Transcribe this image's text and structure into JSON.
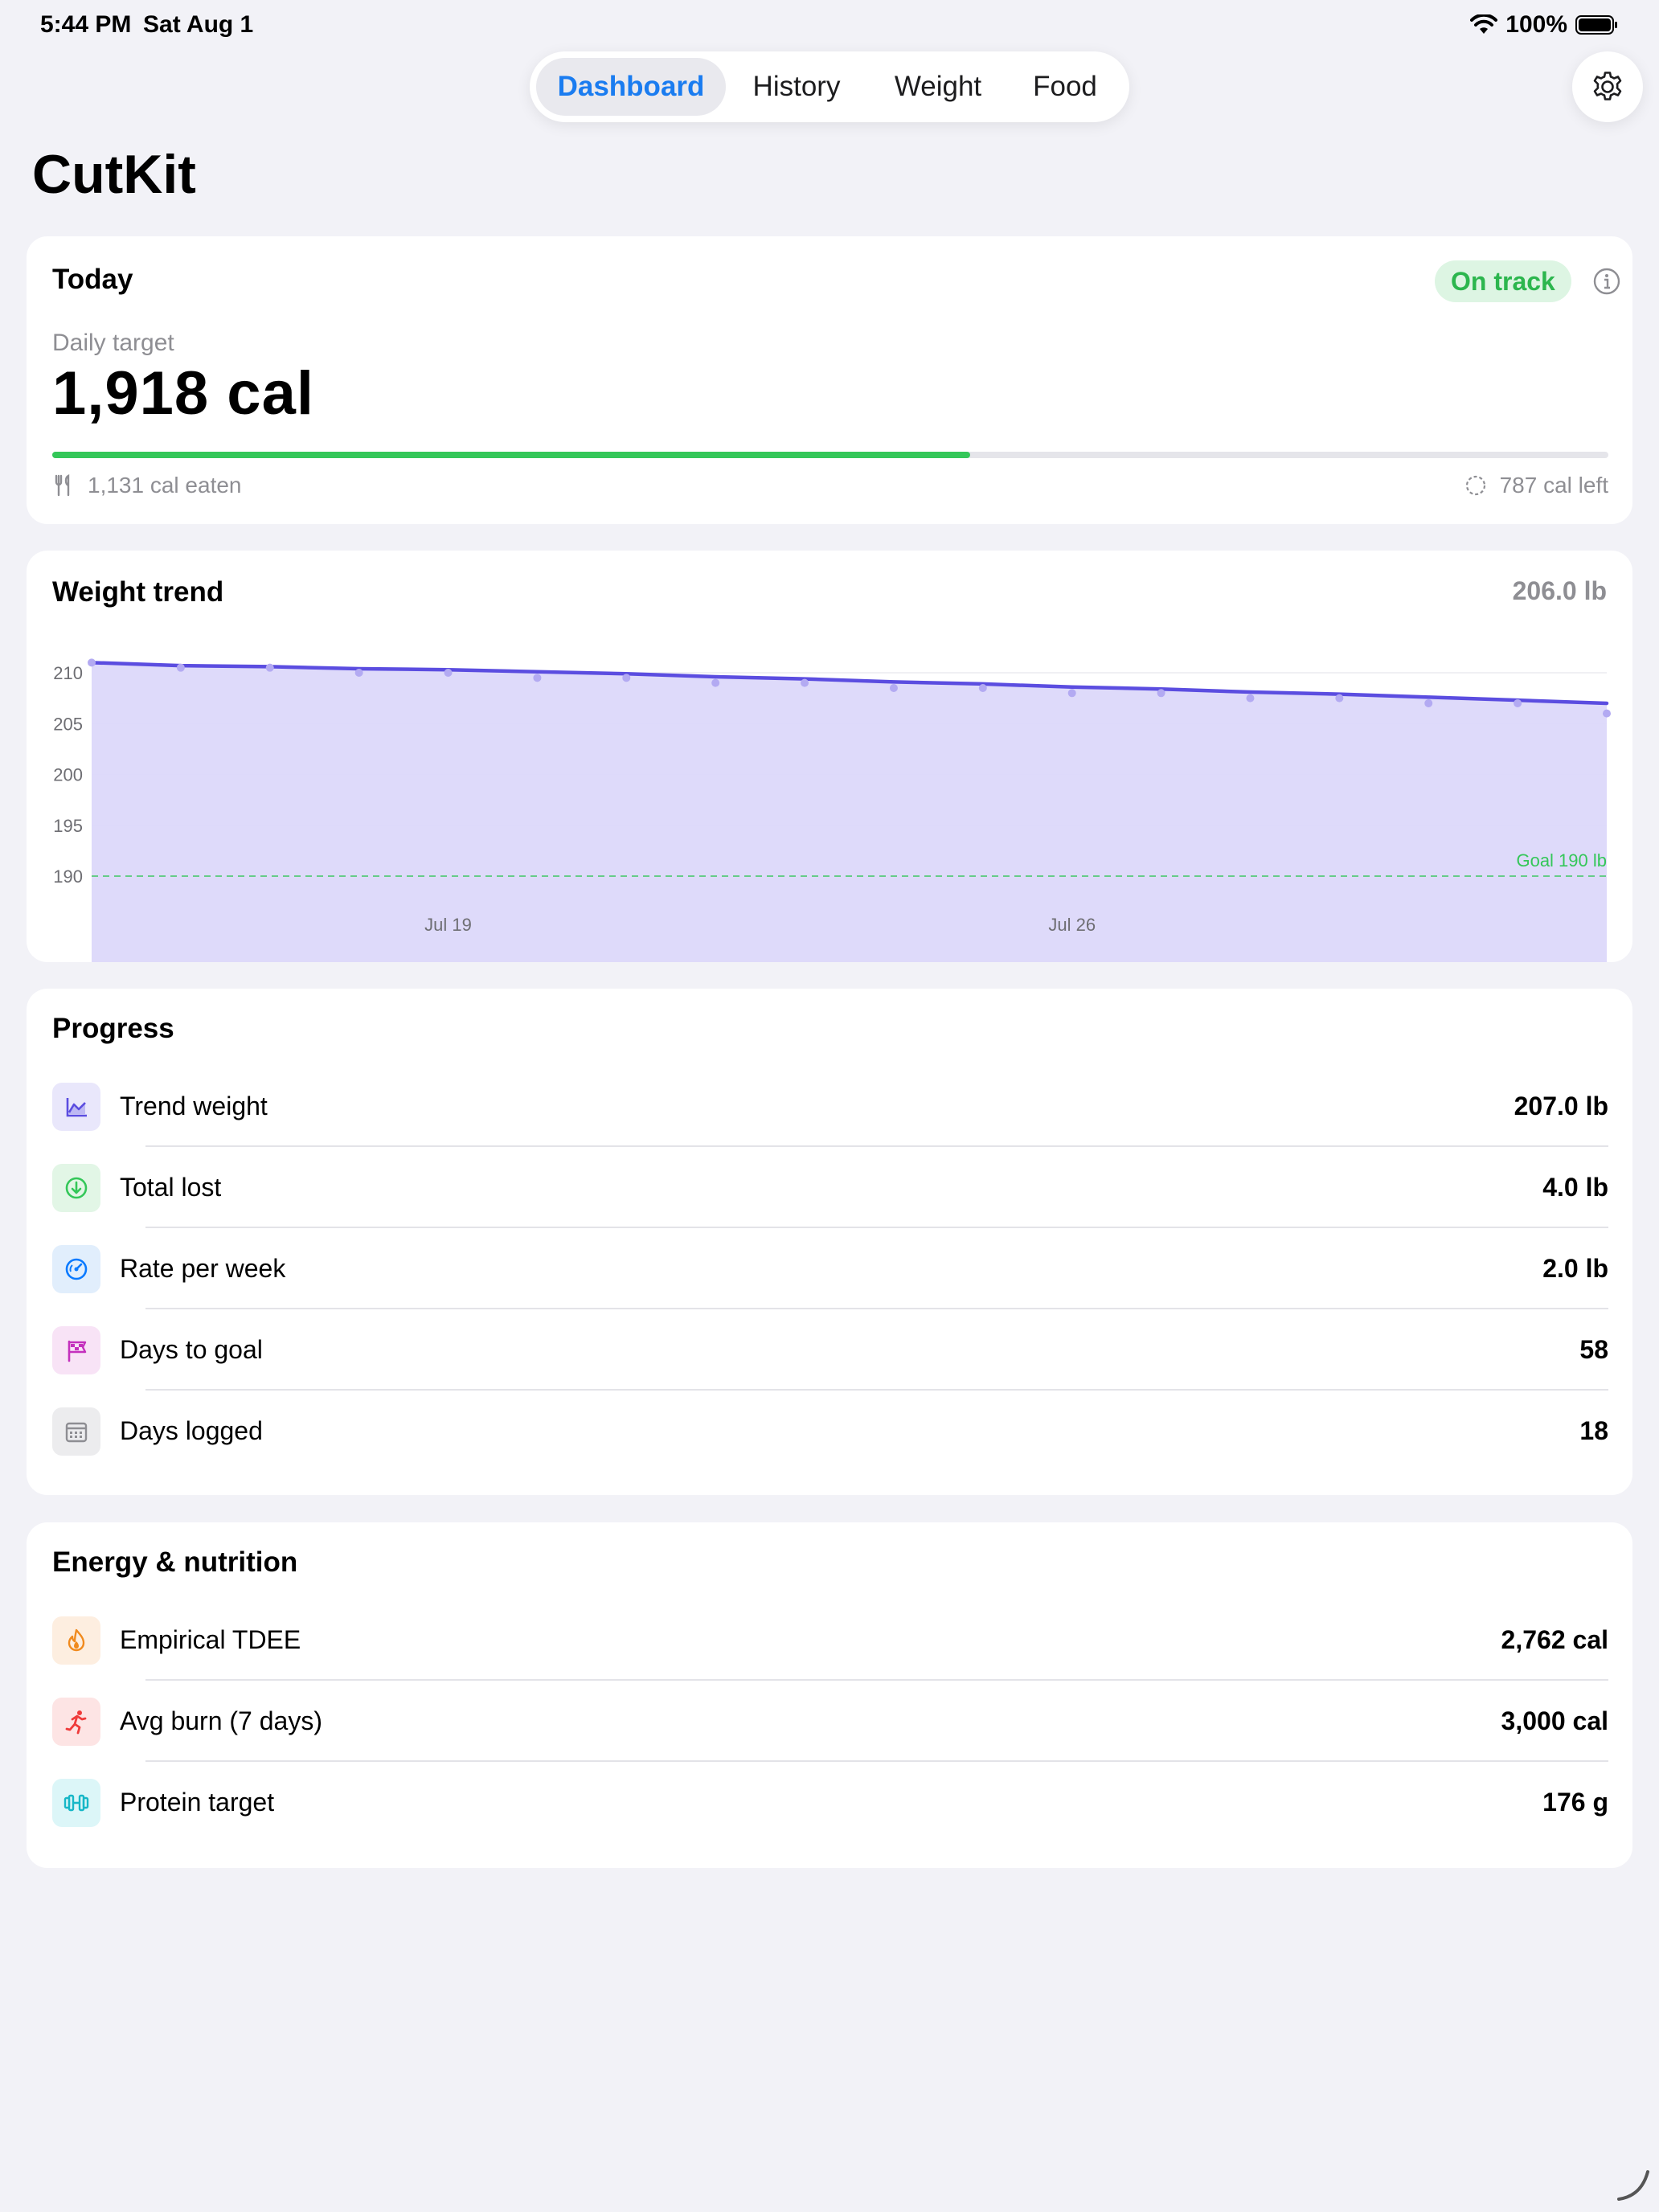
{
  "status_bar": {
    "time": "5:44 PM",
    "date": "Sat Aug 1",
    "battery": "100%"
  },
  "nav": {
    "tabs": [
      "Dashboard",
      "History",
      "Weight",
      "Food"
    ],
    "active": "Dashboard"
  },
  "app_title": "CutKit",
  "today": {
    "heading": "Today",
    "status_badge": "On track",
    "daily_target_label": "Daily target",
    "daily_target_value": "1,918 cal",
    "eaten": "1,131 cal eaten",
    "left": "787 cal left",
    "progress_fraction": 0.59
  },
  "weight_trend": {
    "heading": "Weight trend",
    "current": "206.0 lb",
    "goal_label": "Goal 190 lb"
  },
  "chart_data": {
    "type": "area",
    "yticks": [
      210,
      205,
      200,
      195,
      190
    ],
    "xticks": [
      "Jul 19",
      "Jul 26"
    ],
    "ylim": [
      181.5,
      211.5
    ],
    "goal": 190,
    "x": [
      "Jul 15",
      "Jul 16",
      "Jul 17",
      "Jul 18",
      "Jul 19",
      "Jul 20",
      "Jul 21",
      "Jul 22",
      "Jul 23",
      "Jul 24",
      "Jul 25",
      "Jul 26",
      "Jul 27",
      "Jul 28",
      "Jul 29",
      "Jul 30",
      "Jul 31",
      "Aug 1"
    ],
    "series": [
      {
        "values": [
          211.0,
          210.7,
          210.6,
          210.4,
          210.3,
          210.1,
          209.9,
          209.6,
          209.4,
          209.1,
          208.9,
          208.6,
          208.4,
          208.1,
          207.9,
          207.6,
          207.3,
          207.0
        ]
      },
      {
        "values": [
          211.0,
          210.5,
          210.5,
          210.0,
          210.0,
          209.5,
          209.5,
          209.0,
          209.0,
          208.5,
          208.5,
          208.0,
          208.0,
          207.5,
          207.5,
          207.0,
          207.0,
          206.0
        ]
      }
    ],
    "colors": {
      "line": "#5b4de0",
      "fill": "#dcd8fa",
      "points": "#b3aaf2",
      "goal": "#34c759"
    }
  },
  "progress": {
    "heading": "Progress",
    "rows": [
      {
        "label": "Trend weight",
        "value": "207.0 lb",
        "icon": "chart-line-icon",
        "bg": "#e9e7fb",
        "fg": "#5b4de0"
      },
      {
        "label": "Total lost",
        "value": "4.0 lb",
        "icon": "arrow-down-circle-icon",
        "bg": "#e2f6e6",
        "fg": "#34c759"
      },
      {
        "label": "Rate per week",
        "value": "2.0 lb",
        "icon": "gauge-icon",
        "bg": "#e1eefc",
        "fg": "#0a7aff"
      },
      {
        "label": "Days to goal",
        "value": "58",
        "icon": "flag-checkered-icon",
        "bg": "#f8e3f6",
        "fg": "#c430bd"
      },
      {
        "label": "Days logged",
        "value": "18",
        "icon": "calendar-icon",
        "bg": "#ececee",
        "fg": "#8e8e93"
      }
    ]
  },
  "energy": {
    "heading": "Energy & nutrition",
    "rows": [
      {
        "label": "Empirical TDEE",
        "value": "2,762 cal",
        "icon": "flame-icon",
        "bg": "#fdeee0",
        "fg": "#f08a1d"
      },
      {
        "label": "Avg burn (7 days)",
        "value": "3,000 cal",
        "icon": "running-figure-icon",
        "bg": "#fde4e4",
        "fg": "#ef3b3b"
      },
      {
        "label": "Protein target",
        "value": "176 g",
        "icon": "dumbbell-icon",
        "bg": "#dcf6f8",
        "fg": "#17b7c7"
      }
    ]
  }
}
